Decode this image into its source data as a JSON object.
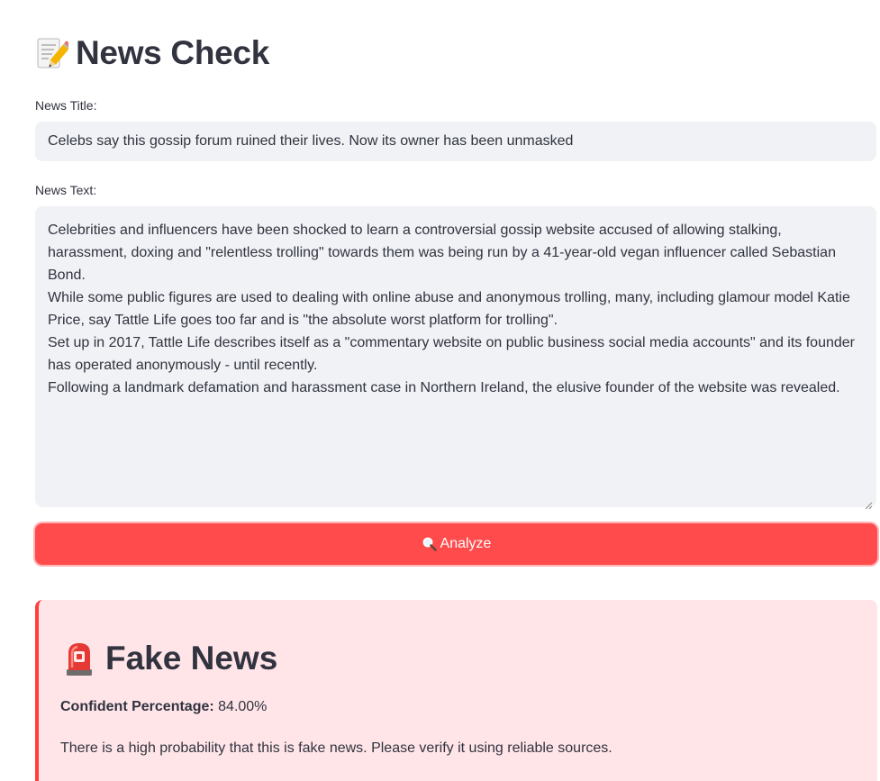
{
  "header": {
    "title": "News Check",
    "icon": "memo-icon"
  },
  "form": {
    "title_label": "News Title:",
    "title_value": "Celebs say this gossip forum ruined their lives. Now its owner has been unmasked",
    "text_label": "News Text:",
    "text_paragraphs": [
      "Celebrities and influencers have been shocked to learn a controversial gossip website accused of allowing stalking, harassment, doxing and \"relentless trolling\" towards them was being run by a 41-year-old vegan influencer called Sebastian Bond.",
      "While some public figures are used to dealing with online abuse and anonymous trolling, many, including glamour model Katie Price, say Tattle Life goes too far and is \"the absolute worst platform for trolling\".",
      "Set up in 2017, Tattle Life describes itself as a \"commentary website on public business social media accounts\" and its founder has operated anonymously - until recently.",
      "Following a landmark defamation and harassment case in Northern Ireland, the elusive founder of the website was revealed."
    ],
    "analyze_label": "Analyze",
    "analyze_icon": "magnifier-icon"
  },
  "result": {
    "icon": "siren-icon",
    "heading": "Fake News",
    "confidence_label": "Confident Percentage:",
    "confidence_value": "84.00%",
    "message": "There is a high probability that this is fake news. Please verify it using reliable sources."
  },
  "colors": {
    "primary": "#ff4b4b",
    "input_bg": "#f0f2f6",
    "alert_bg": "#ffe5e8",
    "alert_border": "#ff3d3d",
    "text": "#31333f"
  }
}
